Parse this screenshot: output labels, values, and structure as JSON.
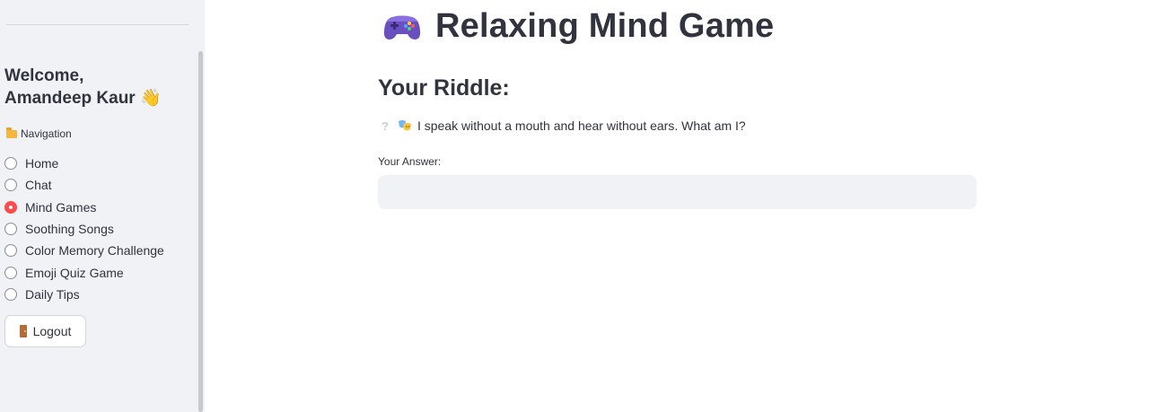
{
  "sidebar": {
    "welcome_line1": "Welcome,",
    "welcome_line2": "Amandeep Kaur",
    "welcome_emoji": "👋",
    "nav_label": "Navigation",
    "nav_items": [
      {
        "label": "Home",
        "selected": false
      },
      {
        "label": "Chat",
        "selected": false
      },
      {
        "label": "Mind Games",
        "selected": true
      },
      {
        "label": "Soothing Songs",
        "selected": false
      },
      {
        "label": "Color Memory Challenge",
        "selected": false
      },
      {
        "label": "Emoji Quiz Game",
        "selected": false
      },
      {
        "label": "Daily Tips",
        "selected": false
      }
    ],
    "logout_label": "Logout",
    "accent_color": "#ff4b4b",
    "icons": {
      "nav": "folder-icon",
      "logout": "door-icon",
      "welcome": "waving-hand-icon"
    }
  },
  "main": {
    "title": "Relaxing Mind Game",
    "title_icon": "gamepad-icon",
    "riddle_heading": "Your Riddle:",
    "riddle_text": "I speak without a mouth and hear without ears. What am I?",
    "riddle_icons": [
      "question-icon",
      "masks-icon"
    ],
    "answer_label": "Your Answer:",
    "answer_value": "",
    "answer_placeholder": ""
  }
}
